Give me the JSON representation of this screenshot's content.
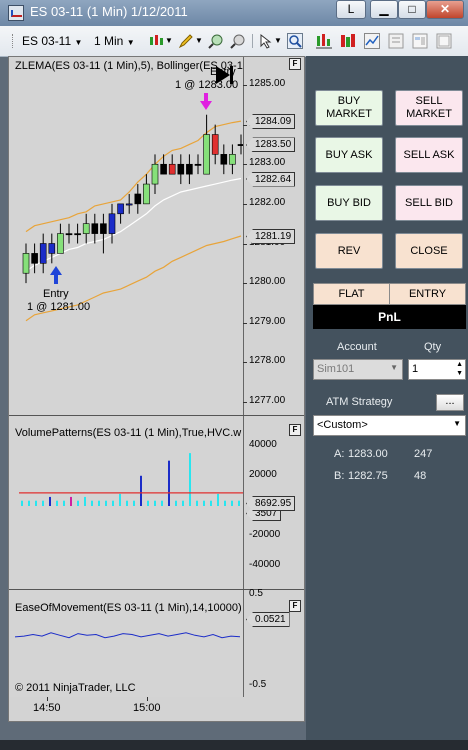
{
  "window": {
    "title": "ES 03-11 (1 Min)  1/12/2011",
    "buttons": {
      "link": "L",
      "minimize": "▁",
      "maximize": "□",
      "close": "✕"
    }
  },
  "toolbar": {
    "instrument": "ES 03-11",
    "interval": "1 Min"
  },
  "chart": {
    "price_title": "ZLEMA(ES 03-11 (1 Min),5), Bollinger(ES 03-1",
    "price_ticks": [
      "1285.00",
      "1284.00",
      "1283.00",
      "1282.00",
      "1281.00",
      "1280.00",
      "1279.00",
      "1278.00",
      "1277.00"
    ],
    "price_flags": [
      "1284.09",
      "1283.50",
      "1282.64",
      "1281.19"
    ],
    "entry_top": {
      "label": "Entry",
      "detail": "1 @ 1283.00"
    },
    "entry_bottom": {
      "label": "Entry",
      "detail": "1 @ 1281.00"
    },
    "volume_title": "VolumePatterns(ES 03-11 (1 Min),True,HVC.w",
    "volume_ticks": [
      "40000",
      "20000",
      "0",
      "-20000",
      "-40000"
    ],
    "volume_flags": [
      "8692.95",
      "3507"
    ],
    "eom_title": "EaseOfMovement(ES 03-11 (1 Min),14,10000)",
    "eom_ticks": [
      "0.5",
      "-0.5"
    ],
    "eom_flag": "0.0521",
    "copyright": "© 2011 NinjaTrader, LLC",
    "x_labels": [
      "14:50",
      "15:00"
    ],
    "f_label": "F"
  },
  "chart_data": [
    {
      "type": "candlestick",
      "title": "ZLEMA(ES 03-11 (1 Min),5), Bollinger(ES 03-1",
      "ylim": [
        1276.75,
        1285.5
      ],
      "candles": [
        {
          "o": 1280.25,
          "c": 1280.75,
          "h": 1281.0,
          "l": 1280.0,
          "color": "green"
        },
        {
          "o": 1280.75,
          "c": 1280.5,
          "h": 1281.0,
          "l": 1280.25,
          "color": "black"
        },
        {
          "o": 1280.5,
          "c": 1281.0,
          "h": 1281.25,
          "l": 1280.25,
          "color": "blue"
        },
        {
          "o": 1281.0,
          "c": 1280.75,
          "h": 1281.25,
          "l": 1280.5,
          "color": "blue"
        },
        {
          "o": 1280.75,
          "c": 1281.25,
          "h": 1281.5,
          "l": 1280.75,
          "color": "green"
        },
        {
          "o": 1281.25,
          "c": 1281.25,
          "h": 1281.5,
          "l": 1281.0,
          "color": "black"
        },
        {
          "o": 1281.25,
          "c": 1281.25,
          "h": 1281.5,
          "l": 1281.0,
          "color": "black"
        },
        {
          "o": 1281.25,
          "c": 1281.5,
          "h": 1281.75,
          "l": 1281.0,
          "color": "green"
        },
        {
          "o": 1281.5,
          "c": 1281.25,
          "h": 1281.75,
          "l": 1281.0,
          "color": "black"
        },
        {
          "o": 1281.25,
          "c": 1281.5,
          "h": 1281.75,
          "l": 1280.75,
          "color": "black"
        },
        {
          "o": 1281.25,
          "c": 1281.75,
          "h": 1282.0,
          "l": 1281.0,
          "color": "blue"
        },
        {
          "o": 1281.75,
          "c": 1282.0,
          "h": 1282.0,
          "l": 1281.5,
          "color": "blue"
        },
        {
          "o": 1282.0,
          "c": 1282.0,
          "h": 1282.25,
          "l": 1281.75,
          "color": "blue"
        },
        {
          "o": 1282.0,
          "c": 1282.25,
          "h": 1282.5,
          "l": 1281.75,
          "color": "black"
        },
        {
          "o": 1282.0,
          "c": 1282.5,
          "h": 1282.75,
          "l": 1282.0,
          "color": "green"
        },
        {
          "o": 1282.5,
          "c": 1283.0,
          "h": 1283.25,
          "l": 1282.25,
          "color": "green"
        },
        {
          "o": 1283.0,
          "c": 1282.75,
          "h": 1283.25,
          "l": 1282.75,
          "color": "black"
        },
        {
          "o": 1282.75,
          "c": 1283.0,
          "h": 1283.25,
          "l": 1282.75,
          "color": "red"
        },
        {
          "o": 1283.0,
          "c": 1282.75,
          "h": 1283.25,
          "l": 1282.5,
          "color": "black"
        },
        {
          "o": 1282.75,
          "c": 1283.0,
          "h": 1283.25,
          "l": 1282.5,
          "color": "black"
        },
        {
          "o": 1283.0,
          "c": 1283.0,
          "h": 1283.25,
          "l": 1282.75,
          "color": "black"
        },
        {
          "o": 1282.75,
          "c": 1283.75,
          "h": 1284.25,
          "l": 1282.75,
          "color": "green"
        },
        {
          "o": 1283.75,
          "c": 1283.25,
          "h": 1284.0,
          "l": 1283.0,
          "color": "red"
        },
        {
          "o": 1283.25,
          "c": 1283.0,
          "h": 1283.5,
          "l": 1282.75,
          "color": "black"
        },
        {
          "o": 1283.0,
          "c": 1283.25,
          "h": 1283.5,
          "l": 1282.75,
          "color": "green"
        },
        {
          "o": 1283.5,
          "c": 1283.5,
          "h": 1283.75,
          "l": 1283.25,
          "color": "black"
        }
      ],
      "upper_band": [
        1281.3,
        1281.45,
        1281.5,
        1281.55,
        1281.6,
        1281.65,
        1281.75,
        1281.8,
        1281.95,
        1282.0,
        1282.05,
        1282.1,
        1282.3,
        1282.55,
        1282.75,
        1283.0,
        1283.2,
        1283.35,
        1283.4,
        1283.5,
        1283.6,
        1283.8,
        1283.95,
        1284.0,
        1284.05,
        1284.09
      ],
      "lower_band": [
        1279.05,
        1279.2,
        1279.25,
        1279.3,
        1279.35,
        1279.4,
        1279.45,
        1279.55,
        1279.65,
        1279.75,
        1279.8,
        1279.85,
        1279.95,
        1280.05,
        1280.15,
        1280.3,
        1280.4,
        1280.55,
        1280.65,
        1280.75,
        1280.85,
        1280.95,
        1281.0,
        1281.05,
        1281.12,
        1281.19
      ],
      "zlema": [
        1280.3,
        1280.45,
        1280.55,
        1280.65,
        1280.75,
        1280.85,
        1280.9,
        1281.0,
        1281.05,
        1281.1,
        1281.2,
        1281.3,
        1281.45,
        1281.6,
        1281.75,
        1281.95,
        1282.1,
        1282.2,
        1282.3,
        1282.35,
        1282.4,
        1282.45,
        1282.5,
        1282.55,
        1282.6,
        1282.64
      ]
    },
    {
      "type": "bar",
      "title": "VolumePatterns(ES 03-11 (1 Min),True,HVC.w",
      "ylim": [
        -45000,
        45000
      ],
      "values": [
        3507,
        3507,
        3507,
        3507,
        6000,
        3507,
        3507,
        6000,
        3507,
        6000,
        3507,
        3507,
        3507,
        3507,
        8000,
        3507,
        3507,
        20000,
        3507,
        3507,
        3507,
        30000,
        3507,
        3507,
        35000,
        3507,
        3507,
        3507,
        8000,
        3507,
        3507,
        3507
      ],
      "colors": [
        "cyan",
        "cyan",
        "cyan",
        "cyan",
        "blue",
        "cyan",
        "cyan",
        "magenta",
        "cyan",
        "cyan",
        "cyan",
        "cyan",
        "cyan",
        "cyan",
        "cyan",
        "cyan",
        "cyan",
        "blue",
        "cyan",
        "cyan",
        "cyan",
        "blue",
        "cyan",
        "cyan",
        "cyan",
        "cyan",
        "cyan",
        "cyan",
        "cyan",
        "cyan",
        "cyan",
        "cyan"
      ],
      "average": 8692.95
    },
    {
      "type": "line",
      "title": "EaseOfMovement(ES 03-11 (1 Min),14,10000)",
      "ylim": [
        -0.7,
        1.1
      ],
      "values": [
        0.05,
        0.06,
        0.08,
        0.06,
        0.1,
        0.07,
        0.04,
        0.09,
        0.07,
        0.08,
        0.04,
        0.06,
        0.09,
        0.08,
        0.05,
        0.07,
        0.09,
        0.06,
        0.08,
        0.1,
        0.07,
        0.05,
        0.08,
        0.04,
        0.06,
        0.0521
      ]
    }
  ],
  "order_panel": {
    "buttons": {
      "buy_market": "BUY\nMARKET",
      "sell_market": "SELL\nMARKET",
      "buy_ask": "BUY ASK",
      "sell_ask": "SELL ASK",
      "buy_bid": "BUY BID",
      "sell_bid": "SELL BID",
      "rev": "REV",
      "close": "CLOSE"
    },
    "flat": "FLAT",
    "entry": "ENTRY",
    "pnl": "PnL",
    "account_label": "Account",
    "qty_label": "Qty",
    "account_value": "Sim101",
    "qty_value": "1",
    "atm_label": "ATM Strategy",
    "atm_more": "...",
    "atm_value": "<Custom>",
    "quotes": [
      {
        "side": "A:",
        "price": "1283.00",
        "size": "247"
      },
      {
        "side": "B:",
        "price": "1282.75",
        "size": "48"
      }
    ]
  },
  "colors": {
    "up": "#86e07a",
    "down": "#e03030",
    "blue_bar": "#1b2cc8",
    "band": "#e8a43a",
    "zlema": "#ffffff",
    "entry_up": "#1f44d8",
    "entry_down": "#e020e0",
    "panel_bg": "#44525e"
  }
}
